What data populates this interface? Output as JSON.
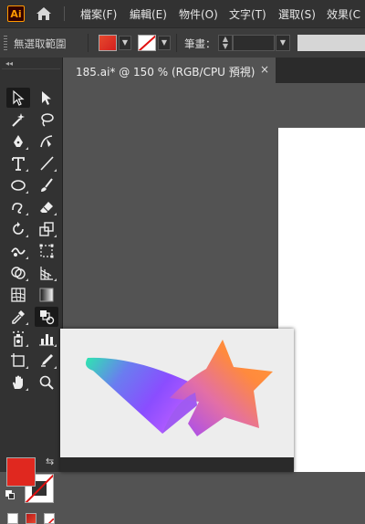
{
  "app": {
    "logo_text": "Ai"
  },
  "menu": {
    "items": [
      {
        "label": "檔案(F)"
      },
      {
        "label": "編輯(E)"
      },
      {
        "label": "物件(O)"
      },
      {
        "label": "文字(T)"
      },
      {
        "label": "選取(S)"
      },
      {
        "label": "效果(C"
      }
    ]
  },
  "control_bar": {
    "selection_status": "無選取範圍",
    "stroke_label": "筆畫：",
    "stroke_value": ""
  },
  "document": {
    "tab_title": "185.ai* @ 150 % (RGB/CPU 預視)",
    "close_glyph": "×"
  },
  "toolbar": {
    "collapse_glyph": "◂◂",
    "swap_glyph": "⇆"
  },
  "colors": {
    "fill": "#e0281f",
    "stroke": "none",
    "accent_logo": "#ff9a00",
    "artwork_gradient": [
      "#2ee6b0",
      "#8a4dff",
      "#ff8a3d"
    ]
  }
}
